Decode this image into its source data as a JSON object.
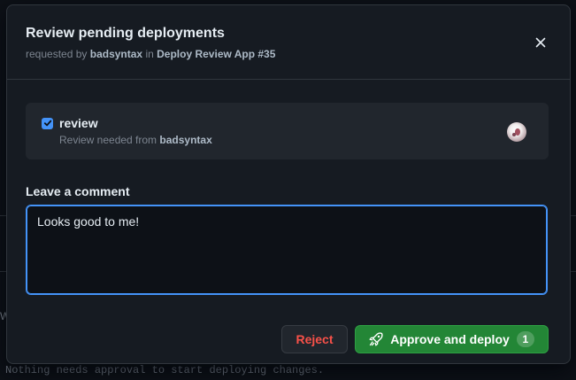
{
  "background": {
    "partial_text": "Nothing needs approval to start deploying changes.",
    "edge_char": "W"
  },
  "dialog": {
    "title": "Review pending deployments",
    "subtitle": {
      "prefix": "requested by",
      "user": "badsyntax",
      "connector": "in",
      "workflow": "Deploy Review App #35"
    },
    "close_icon": "x-icon"
  },
  "environment": {
    "checked": true,
    "name": "review",
    "reviewer_prefix": "Review needed from",
    "reviewer": "badsyntax",
    "avatar_icon": "user-avatar"
  },
  "comment": {
    "label": "Leave a comment",
    "value": "Looks good to me!"
  },
  "actions": {
    "reject_label": "Reject",
    "approve_label": "Approve and deploy",
    "approve_icon": "rocket-icon",
    "approve_count": "1"
  },
  "colors": {
    "dialog_bg": "#161b22",
    "accent_blue": "#4493f8",
    "danger_red": "#f85149",
    "success_green": "#238636"
  }
}
